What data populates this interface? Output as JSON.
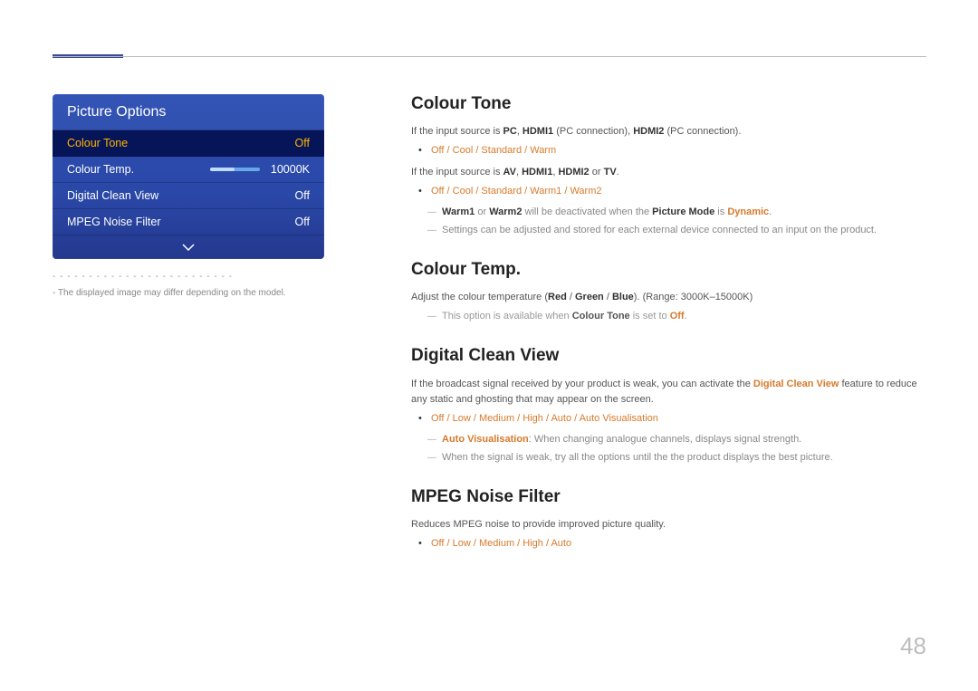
{
  "page_number": "48",
  "osd": {
    "title": "Picture Options",
    "row0": {
      "label": "Colour Tone",
      "value": "Off"
    },
    "row1": {
      "label": "Colour Temp.",
      "value": "10000K"
    },
    "row2": {
      "label": "Digital Clean View",
      "value": "Off"
    },
    "row3": {
      "label": "MPEG Noise Filter",
      "value": "Off"
    }
  },
  "caption_dashes": "- - - - - - - - - - - - - - - - - - - - - - - - -",
  "caption": "- The displayed image may differ depending on the model.",
  "sec1": {
    "h": "Colour Tone",
    "p1a": "If the input source is ",
    "p1_pc": "PC",
    "p1_c1": ", ",
    "p1_h1": "HDMI1",
    "p1_pc1": " (PC connection), ",
    "p1_h2": "HDMI2",
    "p1_pc2": " (PC connection).",
    "opts1": "Off / Cool / Standard / Warm",
    "p2a": "If the input source is ",
    "p2_av": "AV",
    "p2_c1": ", ",
    "p2_h1": "HDMI1",
    "p2_c2": ", ",
    "p2_h2": "HDMI2",
    "p2_or": " or ",
    "p2_tv": "TV",
    "p2_end": ".",
    "opts2": "Off / Cool / Standard / Warm1 / Warm2",
    "sub1_w1": "Warm1",
    "sub1_or": " or ",
    "sub1_w2": "Warm2",
    "sub1_mid": " will be deactivated when the ",
    "sub1_pm": "Picture Mode",
    "sub1_is": " is ",
    "sub1_dy": "Dynamic",
    "sub1_end": ".",
    "sub2": "Settings can be adjusted and stored for each external device connected to an input on the product."
  },
  "sec2": {
    "h": "Colour Temp.",
    "p1a": "Adjust the colour temperature (",
    "p1_r": "Red",
    "p1_s1": " / ",
    "p1_g": "Green",
    "p1_s2": " / ",
    "p1_b": "Blue",
    "p1_end": "). (Range: 3000K–15000K)",
    "sub_a": "This option is available when ",
    "sub_ct": "Colour Tone",
    "sub_b": " is set to ",
    "sub_off": "Off",
    "sub_end": "."
  },
  "sec3": {
    "h": "Digital Clean View",
    "p1a": "If the broadcast signal received by your product is weak, you can activate the ",
    "p1_dcv": "Digital Clean View",
    "p1b": " feature to reduce any static and ghosting that may appear on the screen.",
    "opts": "Off / Low / Medium / High / Auto / Auto Visualisation",
    "sub1_av": "Auto Visualisation",
    "sub1_rest": ": When changing analogue channels, displays signal strength.",
    "sub2": "When the signal is weak, try all the options until the the product displays the best picture."
  },
  "sec4": {
    "h": "MPEG Noise Filter",
    "p1": "Reduces MPEG noise to provide improved picture quality.",
    "opts": "Off / Low / Medium / High / Auto"
  }
}
